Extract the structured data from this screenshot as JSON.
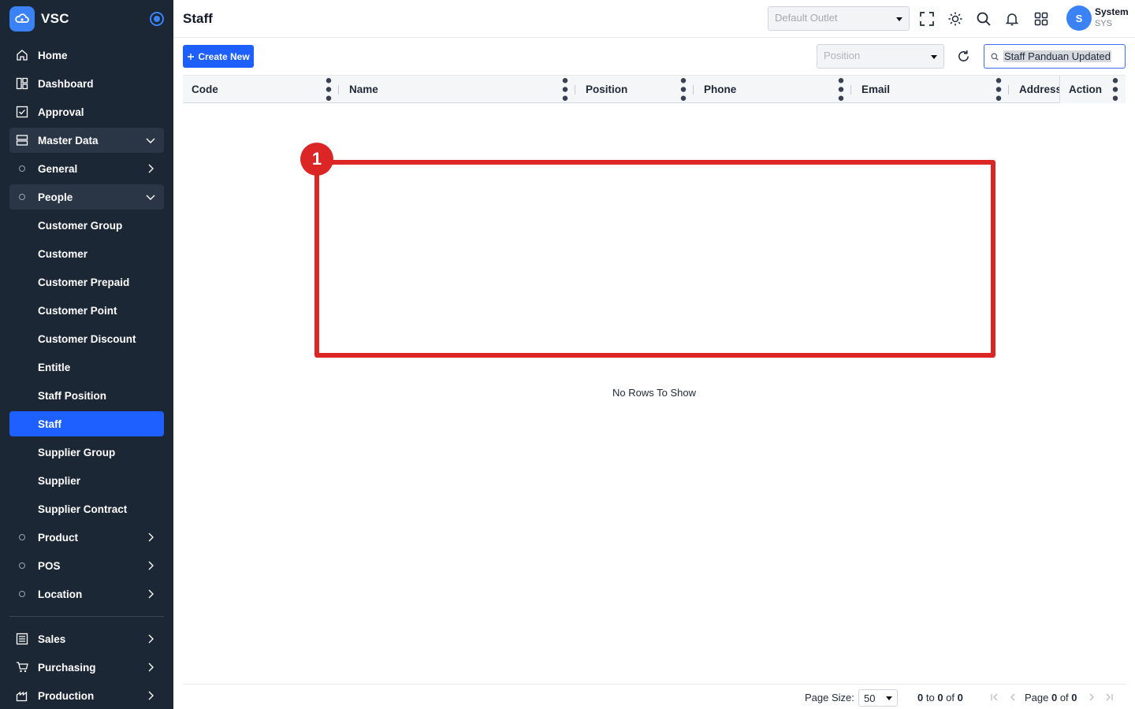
{
  "app": {
    "name": "VSC"
  },
  "sidebar": {
    "items": [
      {
        "label": "Home"
      },
      {
        "label": "Dashboard"
      },
      {
        "label": "Approval"
      },
      {
        "label": "Master Data"
      },
      {
        "label": "General"
      },
      {
        "label": "People"
      },
      {
        "label": "Customer Group"
      },
      {
        "label": "Customer"
      },
      {
        "label": "Customer Prepaid"
      },
      {
        "label": "Customer Point"
      },
      {
        "label": "Customer Discount"
      },
      {
        "label": "Entitle"
      },
      {
        "label": "Staff Position"
      },
      {
        "label": "Staff"
      },
      {
        "label": "Supplier Group"
      },
      {
        "label": "Supplier"
      },
      {
        "label": "Supplier Contract"
      },
      {
        "label": "Product"
      },
      {
        "label": "POS"
      },
      {
        "label": "Location"
      },
      {
        "label": "Sales"
      },
      {
        "label": "Purchasing"
      },
      {
        "label": "Production"
      }
    ],
    "active": "Staff"
  },
  "header": {
    "title": "Staff",
    "outlet_placeholder": "Default Outlet",
    "user": {
      "initial": "S",
      "name": "System",
      "code": "SYS"
    }
  },
  "toolbar": {
    "create_label": "Create New",
    "position_placeholder": "Position",
    "search_value": "Staff Panduan Updated"
  },
  "table": {
    "columns": [
      "Code",
      "Name",
      "Position",
      "Phone",
      "Email",
      "Address",
      "Action"
    ],
    "rows": [],
    "empty_message": "No Rows To Show"
  },
  "annotation": {
    "number": "1"
  },
  "pagination": {
    "page_size_label": "Page Size:",
    "page_size": "50",
    "range_from": "0",
    "range_to": "0",
    "total": "0",
    "page_current": "0",
    "page_total": "0"
  },
  "colors": {
    "sidebar_bg": "#1c2736",
    "accent": "#1e60ff",
    "annotation": "#dc2626"
  }
}
